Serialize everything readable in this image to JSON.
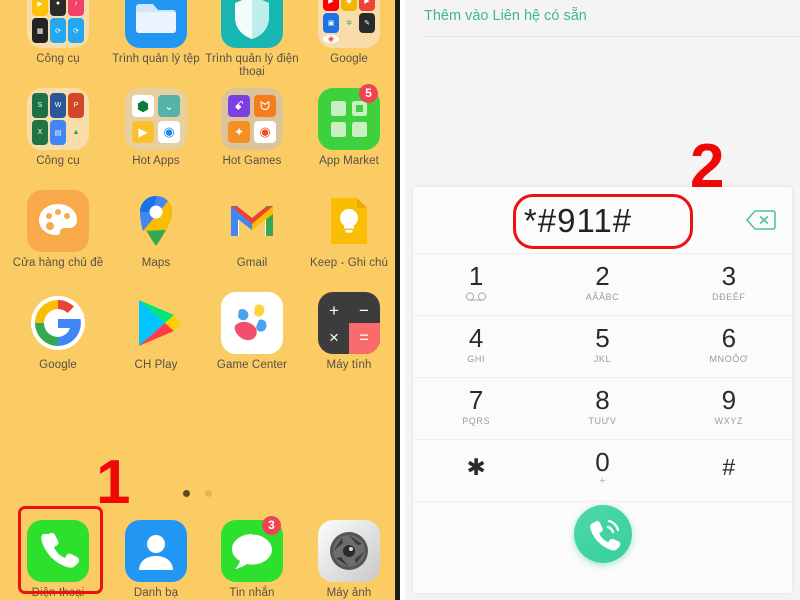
{
  "home": {
    "background_color": "#fbcc64",
    "apps": [
      {
        "label": "Công cụ",
        "icon": "folder-tools-icon",
        "type": "folder"
      },
      {
        "label": "Trình quản lý tệp",
        "icon": "file-manager-icon",
        "type": "app"
      },
      {
        "label": "Trình quản lý điện thoại",
        "icon": "phone-manager-shield-icon",
        "type": "app"
      },
      {
        "label": "Google",
        "icon": "google-folder-icon",
        "type": "folder"
      },
      {
        "label": "Công cụ",
        "icon": "office-folder-icon",
        "type": "folder"
      },
      {
        "label": "Hot Apps",
        "icon": "hot-apps-folder-icon",
        "type": "folder"
      },
      {
        "label": "Hot Games",
        "icon": "hot-games-folder-icon",
        "type": "folder"
      },
      {
        "label": "App Market",
        "icon": "app-market-icon",
        "type": "app",
        "badge": "5"
      },
      {
        "label": "Cửa hàng chủ đề",
        "icon": "theme-store-palette-icon",
        "type": "app"
      },
      {
        "label": "Maps",
        "icon": "google-maps-icon",
        "type": "app"
      },
      {
        "label": "Gmail",
        "icon": "gmail-icon",
        "type": "app"
      },
      {
        "label": "Keep - Ghi chú",
        "icon": "google-keep-icon",
        "type": "app"
      },
      {
        "label": "Google",
        "icon": "google-g-icon",
        "type": "app"
      },
      {
        "label": "CH Play",
        "icon": "play-store-icon",
        "type": "app"
      },
      {
        "label": "Game Center",
        "icon": "game-center-icon",
        "type": "app"
      },
      {
        "label": "Máy tính",
        "icon": "calculator-icon",
        "type": "app"
      }
    ],
    "dock": [
      {
        "label": "Điện thoại",
        "icon": "phone-icon",
        "highlighted": true
      },
      {
        "label": "Danh bạ",
        "icon": "contacts-icon"
      },
      {
        "label": "Tin nhắn",
        "icon": "messages-icon",
        "badge": "3"
      },
      {
        "label": "Máy ảnh",
        "icon": "camera-icon"
      }
    ],
    "page_indicator": {
      "total": 2,
      "active": 1
    }
  },
  "annotations": {
    "step1": "1",
    "step2": "2",
    "color": "#f00808"
  },
  "dialer": {
    "header_text": "Thêm vào Liên hệ có sẵn",
    "header_color": "#3fbb82",
    "number": "*#911#",
    "backspace_icon": "backspace-icon",
    "call_icon": "call-icon",
    "keys": [
      {
        "digit": "1",
        "sub": "",
        "sub_icon": "voicemail-icon"
      },
      {
        "digit": "2",
        "sub": "AĂÂBC"
      },
      {
        "digit": "3",
        "sub": "DĐEÊF"
      },
      {
        "digit": "4",
        "sub": "GHI"
      },
      {
        "digit": "5",
        "sub": "JKL"
      },
      {
        "digit": "6",
        "sub": "MNOÔƠ"
      },
      {
        "digit": "7",
        "sub": "PQRS"
      },
      {
        "digit": "8",
        "sub": "TUƯV"
      },
      {
        "digit": "9",
        "sub": "WXYZ"
      },
      {
        "digit": "✱",
        "sub": ""
      },
      {
        "digit": "0",
        "sub": "+"
      },
      {
        "digit": "#",
        "sub": ""
      }
    ]
  }
}
